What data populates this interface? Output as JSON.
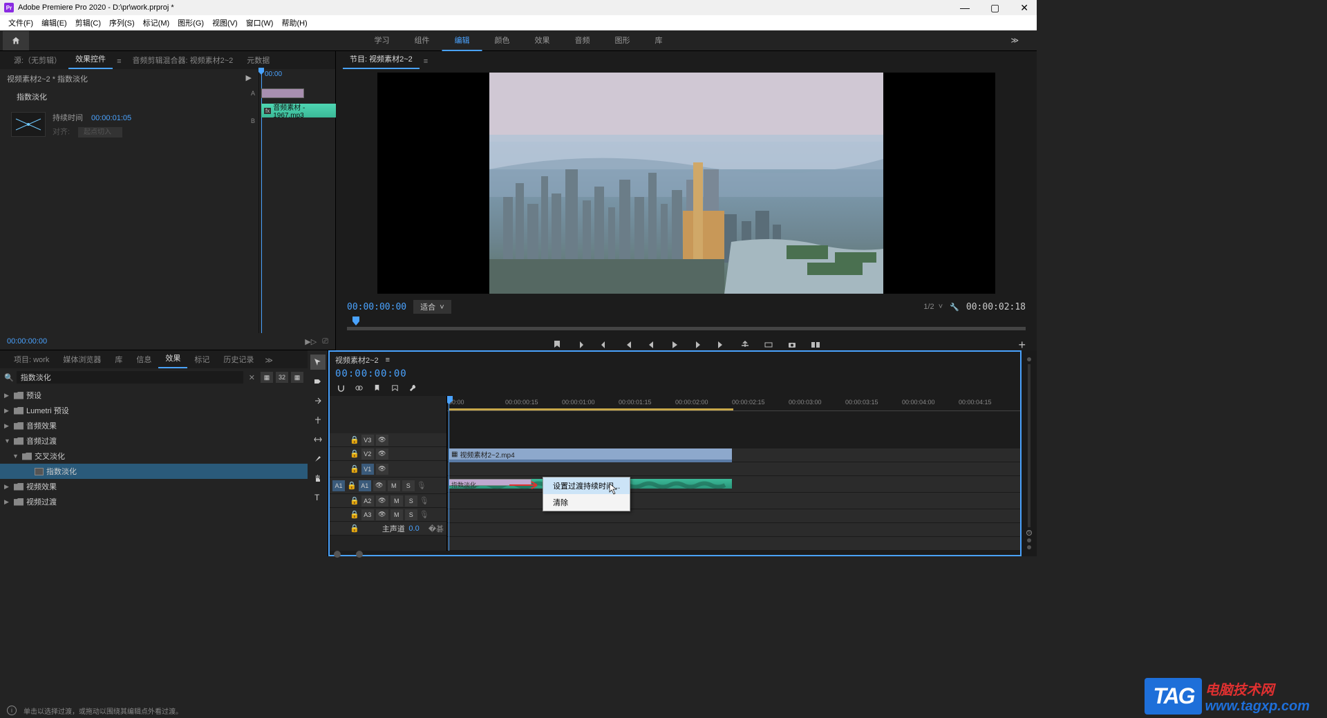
{
  "title": "Adobe Premiere Pro 2020 - D:\\pr\\work.prproj *",
  "menus": [
    "文件(F)",
    "编辑(E)",
    "剪辑(C)",
    "序列(S)",
    "标记(M)",
    "图形(G)",
    "视图(V)",
    "窗口(W)",
    "帮助(H)"
  ],
  "workspaces": {
    "items": [
      "学习",
      "组件",
      "编辑",
      "颜色",
      "效果",
      "音频",
      "图形",
      "库"
    ],
    "active": 2,
    "more": "≫"
  },
  "source_tabs": {
    "items": [
      "源:（无剪辑）",
      "效果控件",
      "音频剪辑混合器: 视频素材2~2",
      "元数据"
    ],
    "active": 1
  },
  "effect_controls": {
    "header": "视频素材2~2 * 指数淡化",
    "name": "指数淡化",
    "duration_label": "持续时间",
    "duration_value": "00:00:01:05",
    "align_label": "对齐:",
    "align_value": "起点切入",
    "timecode": "00:00",
    "clip_label": "音频素材 - 1967.mp3",
    "bottom_tc": "00:00:00:00"
  },
  "program": {
    "tab": "节目: 视频素材2~2",
    "tc": "00:00:00:00",
    "fit": "适合",
    "ratio": "1/2",
    "duration": "00:00:02:18"
  },
  "project_tabs": {
    "items": [
      "项目: work",
      "媒体浏览器",
      "库",
      "信息",
      "效果",
      "标记",
      "历史记录"
    ],
    "active": 4
  },
  "effects_search": "指数淡化",
  "effects_tree": [
    {
      "label": "预设",
      "depth": 0,
      "arrow": "▶",
      "icon": "folder"
    },
    {
      "label": "Lumetri 预设",
      "depth": 0,
      "arrow": "▶",
      "icon": "folder"
    },
    {
      "label": "音频效果",
      "depth": 0,
      "arrow": "▶",
      "icon": "folder"
    },
    {
      "label": "音频过渡",
      "depth": 0,
      "arrow": "▼",
      "icon": "folder"
    },
    {
      "label": "交叉淡化",
      "depth": 1,
      "arrow": "▼",
      "icon": "folder"
    },
    {
      "label": "指数淡化",
      "depth": 2,
      "arrow": "",
      "icon": "preset",
      "selected": true
    },
    {
      "label": "视频效果",
      "depth": 0,
      "arrow": "▶",
      "icon": "folder"
    },
    {
      "label": "视频过渡",
      "depth": 0,
      "arrow": "▶",
      "icon": "folder"
    }
  ],
  "timeline": {
    "tab": "视频素材2~2",
    "tc": "00:00:00:00",
    "ruler": [
      "00:00",
      "00:00:00:15",
      "00:00:01:00",
      "00:00:01:15",
      "00:00:02:00",
      "00:00:02:15",
      "00:00:03:00",
      "00:00:03:15",
      "00:00:04:00",
      "00:00:04:15"
    ],
    "tracks": {
      "v3": "V3",
      "v2": "V2",
      "v1": "V1",
      "a1": "A1",
      "a2": "A2",
      "a3": "A3",
      "src_a1": "A1",
      "master": "主声道",
      "master_vol": "0.0",
      "mute": "M",
      "solo": "S"
    },
    "video_clip": "视频素材2~2.mp4",
    "transition": "指数淡化"
  },
  "context_menu": {
    "item1": "设置过渡持续时间...",
    "item2": "清除"
  },
  "status": "单击以选择过渡，或拖动以围绕其编辑点外看过渡。",
  "tag": {
    "logo": "TAG",
    "t1": "电脑技术网",
    "t2": "www.tagxp.com"
  }
}
